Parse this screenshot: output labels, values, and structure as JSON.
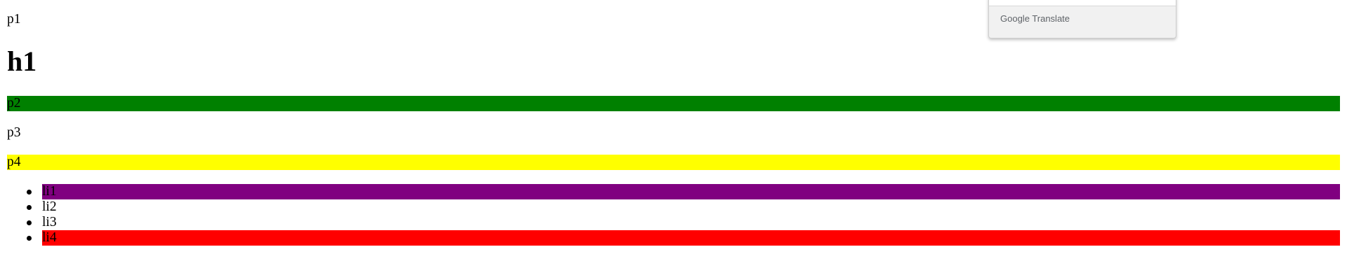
{
  "paragraphs": {
    "p1": "p1",
    "p2": "p2",
    "p3": "p3",
    "p4": "p4"
  },
  "heading": "h1",
  "list_items": [
    "li1",
    "li2",
    "li3",
    "li4"
  ],
  "colors": {
    "p2_bg": "#008000",
    "p4_bg": "#ffff00",
    "li1_bg": "#800080",
    "li4_bg": "#ff0000"
  },
  "translate_popup": {
    "brand": "Google",
    "product": "Translate"
  }
}
